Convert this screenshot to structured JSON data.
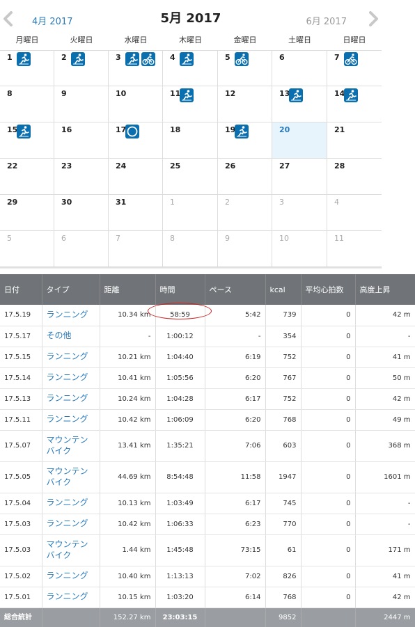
{
  "calendar": {
    "title": "5月 2017",
    "prev_label": "4月 2017",
    "next_label": "6月 2017",
    "weekdays": [
      "月曜日",
      "火曜日",
      "水曜日",
      "木曜日",
      "金曜日",
      "土曜日",
      "日曜日"
    ],
    "today": "20",
    "icon_color": "#0a6fae",
    "days": [
      [
        "1",
        "2",
        "3",
        "4",
        "5",
        "6",
        "7"
      ],
      [
        "8",
        "9",
        "10",
        "11",
        "12",
        "13",
        "14"
      ],
      [
        "15",
        "16",
        "17",
        "18",
        "19",
        "20",
        "21"
      ],
      [
        "22",
        "23",
        "24",
        "25",
        "26",
        "27",
        "28"
      ],
      [
        "29",
        "30",
        "31",
        "1",
        "2",
        "3",
        "4"
      ],
      [
        "5",
        "6",
        "7",
        "8",
        "9",
        "10",
        "11"
      ]
    ],
    "activity_icons": {
      "1": [
        "running-icon"
      ],
      "2": [
        "running-icon"
      ],
      "3": [
        "running-icon",
        "cycling-icon"
      ],
      "4": [
        "running-icon"
      ],
      "5": [
        "cycling-icon"
      ],
      "7": [
        "cycling-icon"
      ],
      "11": [
        "running-icon"
      ],
      "13": [
        "running-icon"
      ],
      "14": [
        "running-icon"
      ],
      "15": [
        "running-icon"
      ],
      "17": [
        "other-icon"
      ],
      "19": [
        "running-icon"
      ]
    }
  },
  "activities": {
    "headers": {
      "date": "日付",
      "type": "タイプ",
      "distance": "距離",
      "time": "時間",
      "pace": "ペース",
      "kcal": "kcal",
      "avg_hr": "平均心拍数",
      "elevation": "高度上昇"
    },
    "rows": [
      {
        "date": "17.5.19",
        "type": "ランニング",
        "distance": "10.34 km",
        "time": "58:59",
        "pace": "5:42",
        "kcal": "739",
        "avg_hr": "0",
        "elevation": "42 m"
      },
      {
        "date": "17.5.17",
        "type": "その他",
        "distance": "-",
        "time": "1:00:12",
        "pace": "-",
        "kcal": "354",
        "avg_hr": "0",
        "elevation": "-"
      },
      {
        "date": "17.5.15",
        "type": "ランニング",
        "distance": "10.21 km",
        "time": "1:04:40",
        "pace": "6:19",
        "kcal": "752",
        "avg_hr": "0",
        "elevation": "41 m"
      },
      {
        "date": "17.5.14",
        "type": "ランニング",
        "distance": "10.41 km",
        "time": "1:05:56",
        "pace": "6:20",
        "kcal": "767",
        "avg_hr": "0",
        "elevation": "50 m"
      },
      {
        "date": "17.5.13",
        "type": "ランニング",
        "distance": "10.24 km",
        "time": "1:04:28",
        "pace": "6:17",
        "kcal": "752",
        "avg_hr": "0",
        "elevation": "42 m"
      },
      {
        "date": "17.5.11",
        "type": "ランニング",
        "distance": "10.42 km",
        "time": "1:06:09",
        "pace": "6:20",
        "kcal": "768",
        "avg_hr": "0",
        "elevation": "49 m"
      },
      {
        "date": "17.5.07",
        "type": "マウンテンバイク",
        "distance": "13.41 km",
        "time": "1:35:21",
        "pace": "7:06",
        "kcal": "603",
        "avg_hr": "0",
        "elevation": "368 m"
      },
      {
        "date": "17.5.05",
        "type": "マウンテンバイク",
        "distance": "44.69 km",
        "time": "8:54:48",
        "pace": "11:58",
        "kcal": "1947",
        "avg_hr": "0",
        "elevation": "1601 m"
      },
      {
        "date": "17.5.04",
        "type": "ランニング",
        "distance": "10.13 km",
        "time": "1:03:49",
        "pace": "6:17",
        "kcal": "745",
        "avg_hr": "0",
        "elevation": "-"
      },
      {
        "date": "17.5.03",
        "type": "ランニング",
        "distance": "10.42 km",
        "time": "1:06:33",
        "pace": "6:23",
        "kcal": "770",
        "avg_hr": "0",
        "elevation": "-"
      },
      {
        "date": "17.5.03",
        "type": "マウンテンバイク",
        "distance": "1.44 km",
        "time": "1:45:48",
        "pace": "73:15",
        "kcal": "61",
        "avg_hr": "0",
        "elevation": "171 m"
      },
      {
        "date": "17.5.02",
        "type": "ランニング",
        "distance": "10.40 km",
        "time": "1:13:13",
        "pace": "7:02",
        "kcal": "826",
        "avg_hr": "0",
        "elevation": "41 m"
      },
      {
        "date": "17.5.01",
        "type": "ランニング",
        "distance": "10.15 km",
        "time": "1:03:20",
        "pace": "6:14",
        "kcal": "768",
        "avg_hr": "0",
        "elevation": "42 m"
      }
    ],
    "total": {
      "label": "総合統計",
      "distance": "152.27 km",
      "time": "23:03:15",
      "pace": "",
      "kcal": "9852",
      "avg_hr": "",
      "elevation": "2447 m"
    },
    "highlight_color": "#c9211e"
  }
}
